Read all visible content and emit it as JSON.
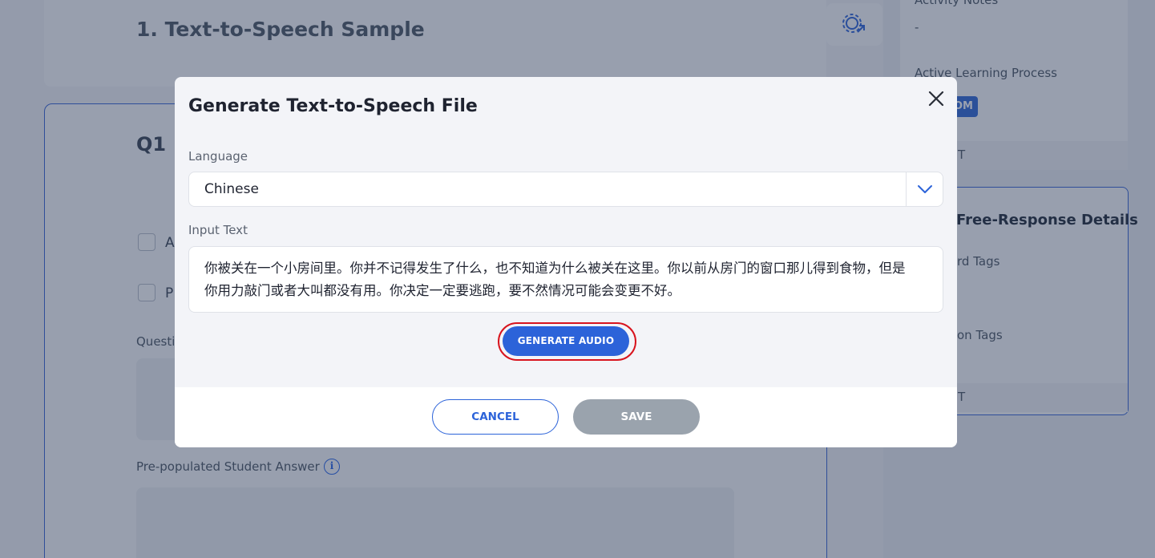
{
  "background": {
    "page_title": "1. Text-to-Speech Sample",
    "question_label": "Q1",
    "checkbox_1_label": "A",
    "checkbox_2_label": "P",
    "question_field_label": "Questi",
    "prepopulated_label": "Pre-populated Student Answer",
    "info_icon_glyph": "i",
    "sidebar": {
      "activity_notes_label": "Activity Notes",
      "activity_notes_value": "-",
      "active_learning_label": "Active Learning Process",
      "badge_text": "OM",
      "panel1_footer": "T",
      "free_response_heading": "Free-Response Details",
      "tags_1": "rd Tags",
      "tags_2": "on Tags",
      "panel2_footer": "T"
    }
  },
  "modal": {
    "title": "Generate Text-to-Speech File",
    "language_label": "Language",
    "language_value": "Chinese",
    "input_text_label": "Input Text",
    "input_text_value": "你被关在一个小房间里。你并不记得发生了什么，也不知道为什么被关在这里。你以前从房门的窗口那儿得到食物，但是你用力敲门或者大叫都没有用。你决定一定要逃跑，要不然情况可能会变更不好。",
    "generate_button": "GENERATE AUDIO",
    "cancel_button": "CANCEL",
    "save_button": "SAVE"
  },
  "colors": {
    "accent": "#2c63d9",
    "highlight_ring": "#d8141e",
    "save_disabled": "#9aa3ad"
  }
}
